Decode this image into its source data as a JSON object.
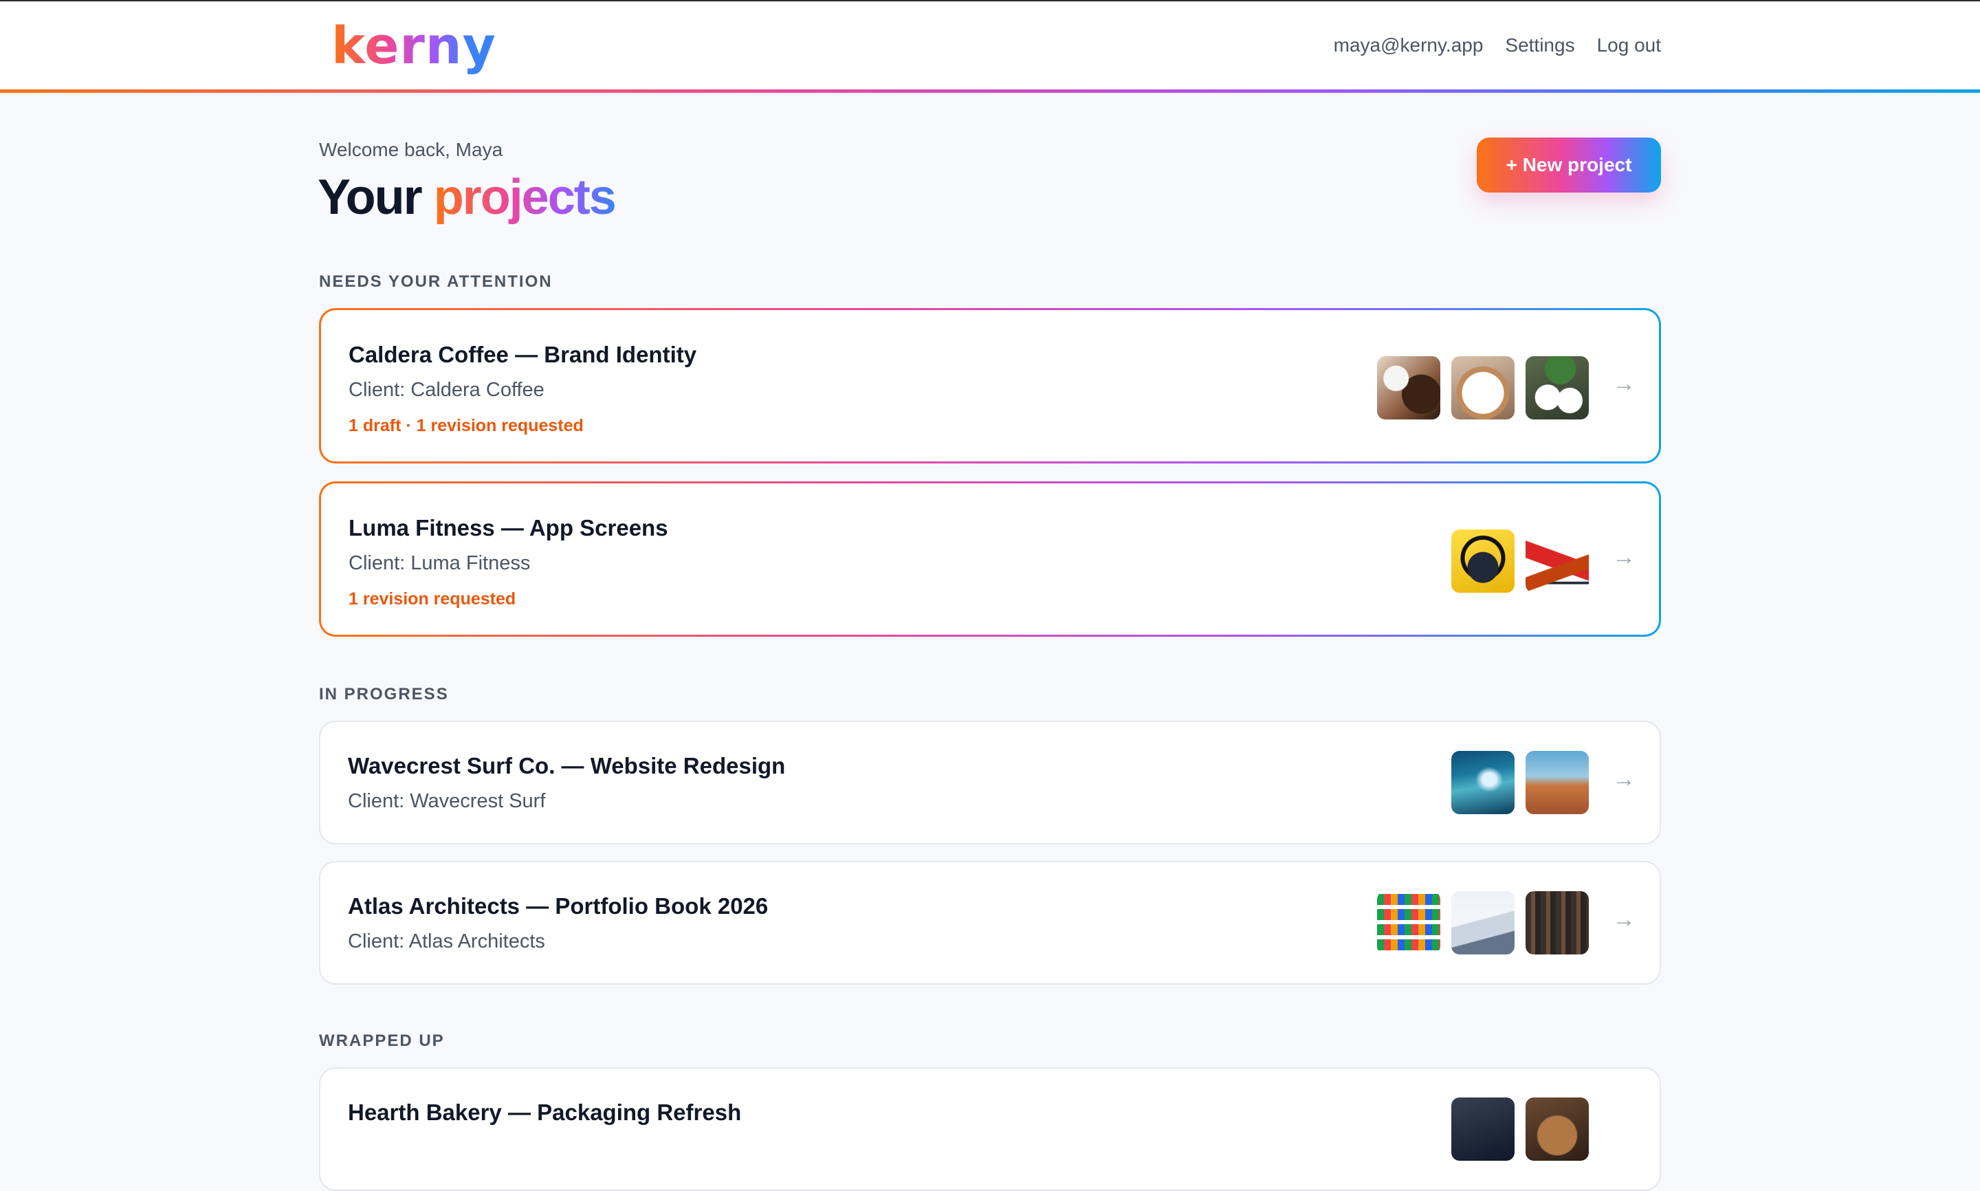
{
  "header": {
    "logo": "kerny",
    "nav": {
      "email": "maya@kerny.app",
      "settings": "Settings",
      "logout": "Log out"
    }
  },
  "page": {
    "welcome": "Welcome back, Maya",
    "title_plain": "Your",
    "title_accent": "projects",
    "new_project_label": "+ New project"
  },
  "sections": {
    "attention": "NEEDS YOUR ATTENTION",
    "in_progress": "IN PROGRESS",
    "wrapped_up": "WRAPPED UP"
  },
  "projects": [
    {
      "title": "Caldera Coffee — Brand Identity",
      "client": "Client: Caldera Coffee",
      "status": "1 draft · 1 revision requested",
      "thumbs": [
        "coffee-beans-image",
        "latte-art-image",
        "coffee-cups-image"
      ]
    },
    {
      "title": "Luma Fitness — App Screens",
      "client": "Client: Luma Fitness",
      "status": "1 revision requested",
      "thumbs": [
        "headphones-image",
        "yoga-image"
      ]
    },
    {
      "title": "Wavecrest Surf Co. — Website Redesign",
      "client": "Client: Wavecrest Surf",
      "thumbs": [
        "surf-wave-image",
        "desert-image"
      ]
    },
    {
      "title": "Atlas Architects — Portfolio Book 2026",
      "client": "Client: Atlas Architects",
      "thumbs": [
        "shelves-image",
        "building-image",
        "library-image"
      ]
    },
    {
      "title": "Hearth Bakery — Packaging Refresh",
      "client": "",
      "thumbs": [
        "dark-image",
        "bread-image"
      ]
    }
  ],
  "colors": {
    "accent_orange": "#f97316",
    "accent_pink": "#ec4899",
    "accent_purple": "#a855f7",
    "accent_blue": "#0ea5e9",
    "status_text": "#ea580c"
  },
  "icons": {
    "arrow": "arrow-right-icon"
  }
}
